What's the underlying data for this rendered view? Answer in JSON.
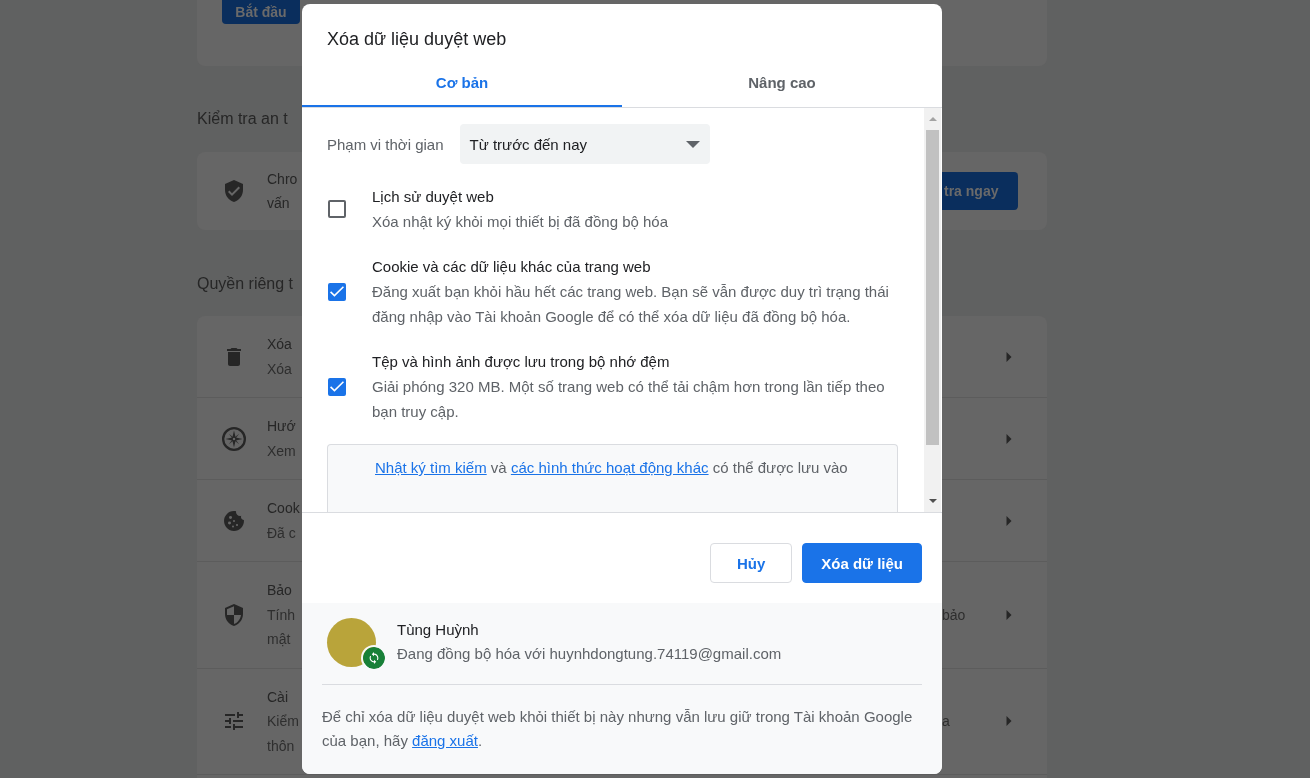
{
  "background_page": {
    "top_card": {
      "button": "Bắt đầu"
    },
    "safety_check": {
      "heading": "Kiểm tra an t",
      "lines": [
        "Chro",
        "vấn"
      ],
      "button": "tra ngay"
    },
    "privacy": {
      "heading": "Quyền riêng t",
      "rows": [
        {
          "title": "Xóa",
          "lines": [
            {
              "left": "Xóa"
            }
          ]
        },
        {
          "title": "Hướ",
          "lines": [
            {
              "left": "Xem"
            }
          ]
        },
        {
          "title": "Cook",
          "lines": [
            {
              "left": "Đã c"
            }
          ]
        },
        {
          "title": "Bảo",
          "lines": [
            {
              "left": "Tính",
              "right": "bảo"
            },
            {
              "left": "mật"
            }
          ]
        },
        {
          "title": "Cài",
          "lines": [
            {
              "left": "Kiểm",
              "right": "a"
            },
            {
              "left": "thôn"
            }
          ]
        }
      ]
    }
  },
  "dialog": {
    "title": "Xóa dữ liệu duyệt web",
    "tabs": [
      {
        "label": "Cơ bản",
        "selected": true
      },
      {
        "label": "Nâng cao",
        "selected": false
      }
    ],
    "time_range": {
      "label": "Phạm vi thời gian",
      "value": "Từ trước đến nay"
    },
    "items": [
      {
        "title": "Lịch sử duyệt web",
        "description": "Xóa nhật ký khỏi mọi thiết bị đã đồng bộ hóa",
        "checked": false
      },
      {
        "title": "Cookie và các dữ liệu khác của trang web",
        "description": "Đăng xuất bạn khỏi hầu hết các trang web. Bạn sẽ vẫn được duy trì trạng thái đăng nhập vào Tài khoản Google để có thể xóa dữ liệu đã đồng bộ hóa.",
        "checked": true
      },
      {
        "title": "Tệp và hình ảnh được lưu trong bộ nhớ đệm",
        "description": "Giải phóng 320 MB. Một số trang web có thể tải chậm hơn trong lần tiếp theo bạn truy cập.",
        "checked": true
      }
    ],
    "info_box": [
      {
        "kind": "link",
        "text": "Nhật ký tìm kiếm"
      },
      {
        "kind": "text",
        "text": " và "
      },
      {
        "kind": "link",
        "text": "các hình thức hoạt động khác"
      },
      {
        "kind": "text",
        "text": " có thể được lưu vào"
      }
    ],
    "buttons": [
      {
        "label": "Hủy",
        "kind": "secondary"
      },
      {
        "label": "Xóa dữ liệu",
        "kind": "primary"
      }
    ],
    "account": {
      "name": "Tùng Huỳnh",
      "status": "Đang đồng bộ hóa với huynhdongtung.74119@gmail.com"
    },
    "sync_note": [
      {
        "kind": "text",
        "text": "Để chỉ xóa dữ liệu duyệt web khỏi thiết bị này nhưng vẫn lưu giữ trong Tài khoản Google của bạn, hãy "
      },
      {
        "kind": "link",
        "text": "đăng xuất"
      },
      {
        "kind": "text",
        "text": "."
      }
    ]
  }
}
